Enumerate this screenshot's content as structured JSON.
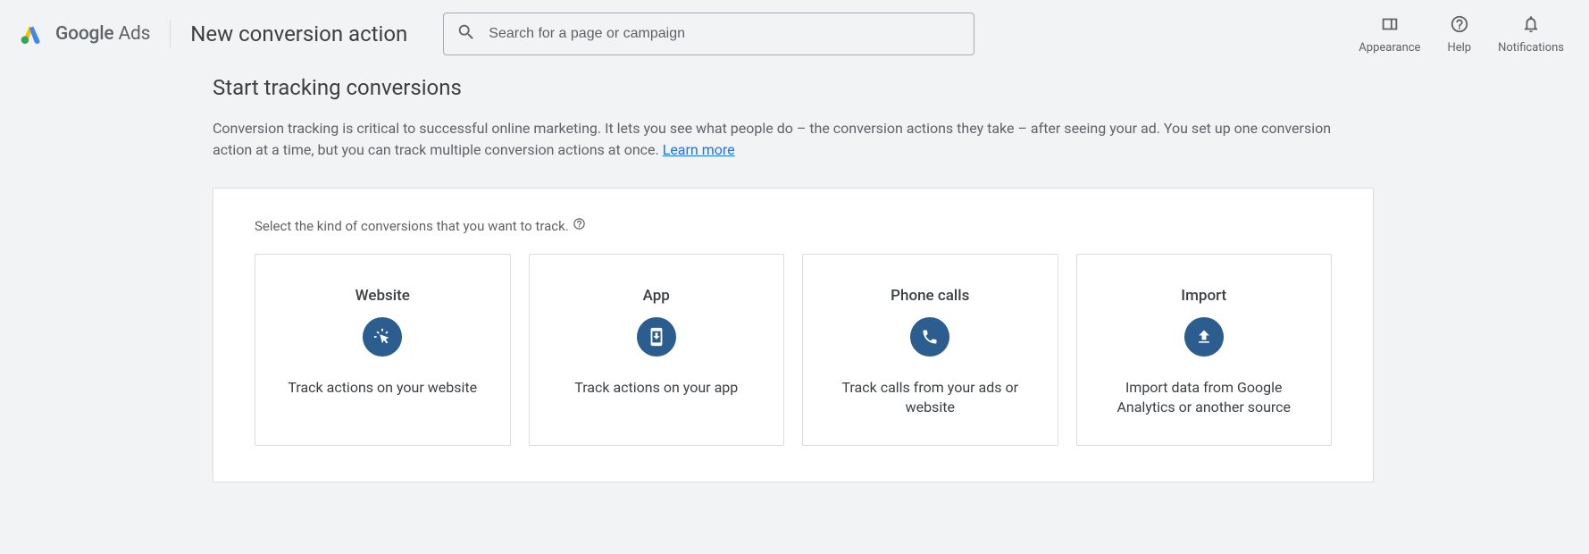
{
  "header": {
    "logo_text_1": "Google",
    "logo_text_2": " Ads",
    "page_title": "New conversion action",
    "search_placeholder": "Search for a page or campaign",
    "actions": {
      "appearance": "Appearance",
      "help": "Help",
      "notifications": "Notifications"
    }
  },
  "main": {
    "title": "Start tracking conversions",
    "description": "Conversion tracking is critical to successful online marketing. It lets you see what people do – the conversion actions they take – after seeing your ad. You set up one conversion action at a time, but you can track multiple conversion actions at once.  ",
    "learn_more": "Learn more",
    "prompt": "Select the kind of conversions that you want to track.",
    "options": [
      {
        "title": "Website",
        "desc": "Track actions on your website"
      },
      {
        "title": "App",
        "desc": "Track actions on your app"
      },
      {
        "title": "Phone calls",
        "desc": "Track calls from your ads or website"
      },
      {
        "title": "Import",
        "desc": "Import data from Google Analytics or another source"
      }
    ]
  }
}
